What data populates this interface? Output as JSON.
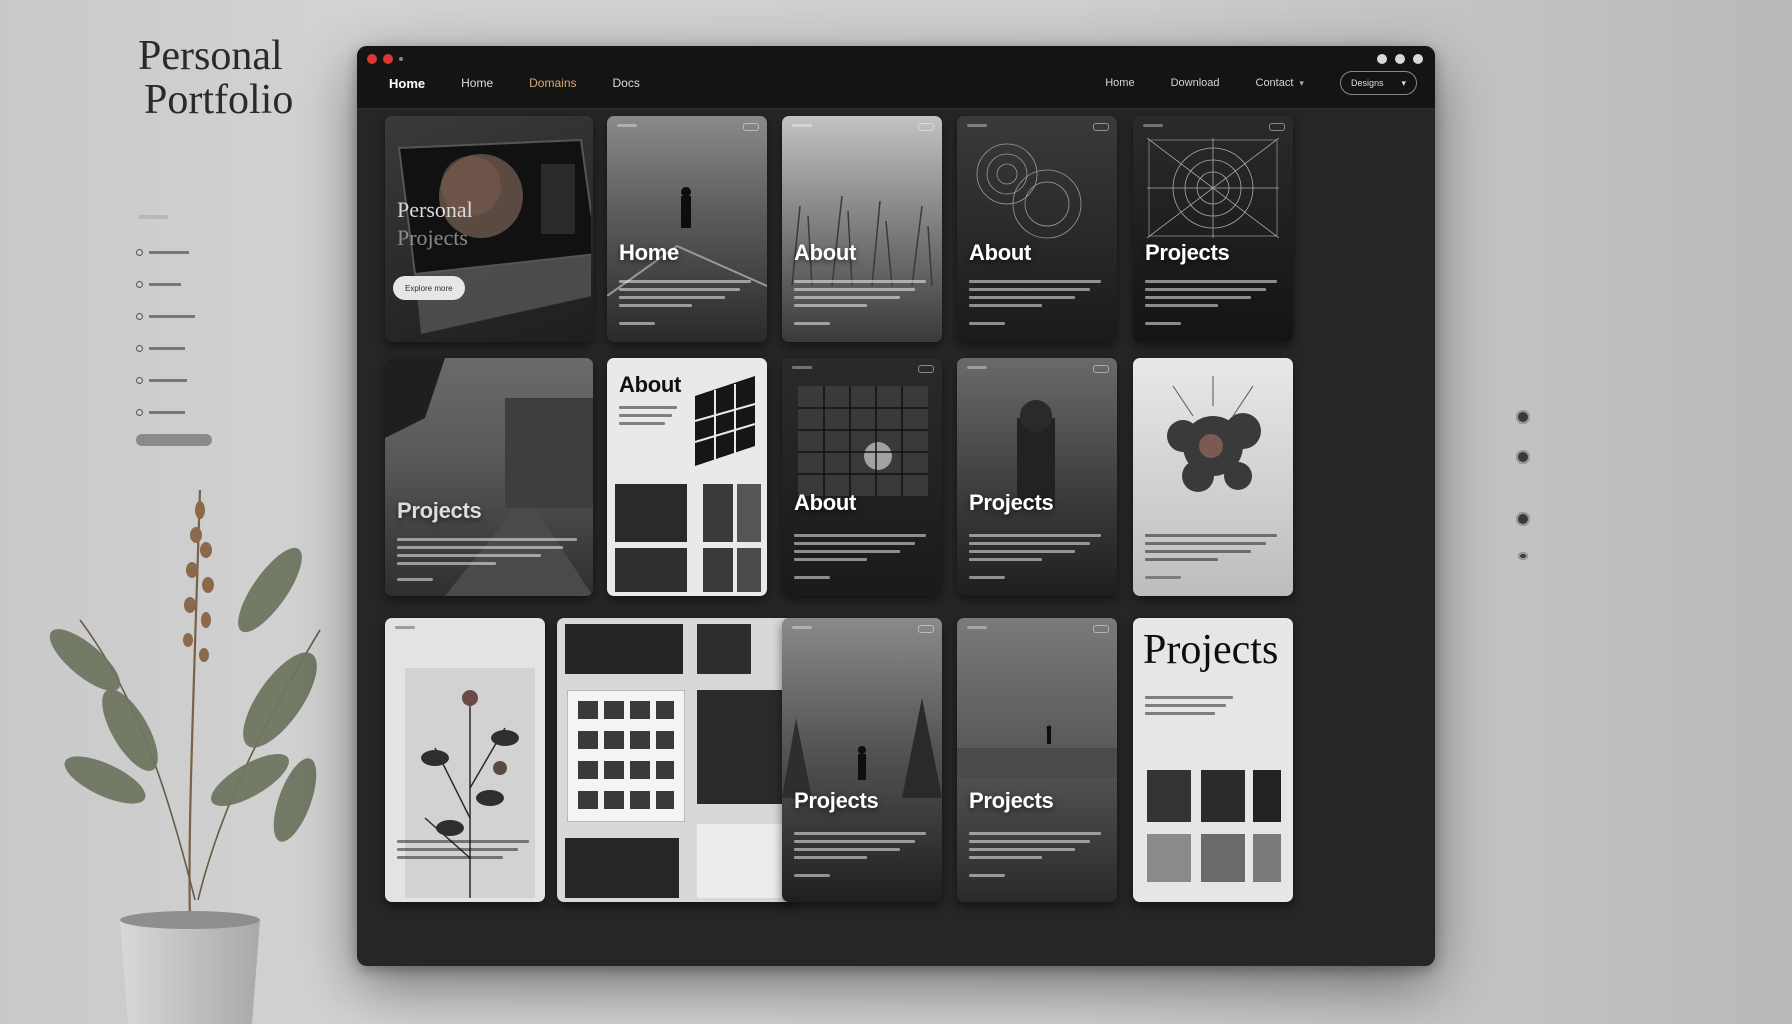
{
  "brand": {
    "line1": "Personal",
    "line2": "Portfolio"
  },
  "top_nav": {
    "left": [
      "Home",
      "Home",
      "Domains",
      "Docs"
    ],
    "right": [
      "Home",
      "Download",
      "Contact"
    ],
    "dropdown_label": "Designs"
  },
  "hero": {
    "title_line1": "Personal",
    "title_line2": "Projects",
    "button_label": "Explore more"
  },
  "cards": {
    "c1_title": "Home",
    "c2_title": "About",
    "c3_title": "About",
    "c4_title": "Projects",
    "c5_title": "Projects",
    "c6_title": "About",
    "c7_title": "About",
    "c8_title": "Projects",
    "c9_title": "Projects",
    "c10_title": "Projects",
    "c11_title": "Projects"
  },
  "colors": {
    "window_bg": "#262628",
    "titlebar_bg": "#141415",
    "accent_close": "#e03434",
    "accent_nav": "#d9a870"
  }
}
